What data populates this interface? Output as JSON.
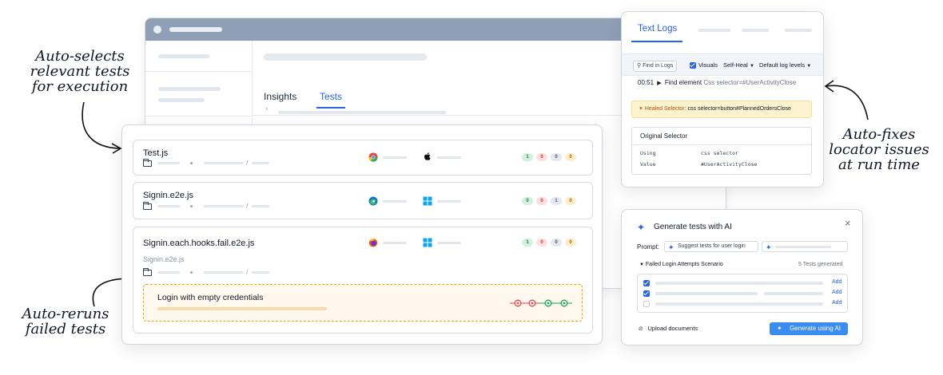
{
  "annotations": {
    "auto_selects": [
      "Auto-selects",
      "relevant tests",
      "for execution"
    ],
    "auto_fixes": [
      "Auto-fixes",
      "locator issues",
      "at run time"
    ],
    "auto_reruns": [
      "Auto-reruns",
      "failed tests"
    ]
  },
  "background_window": {
    "tabs": [
      {
        "label": "Insights",
        "active": false
      },
      {
        "label": "Tests",
        "active": true
      }
    ],
    "chevron": "›"
  },
  "tests": [
    {
      "name": "Test.js",
      "browser_icon": "chrome-icon",
      "os_icon": "apple-icon",
      "counts": {
        "passed": "1",
        "failed": "0",
        "skipped": "0",
        "flaky": "0"
      }
    },
    {
      "name": "Signin.e2e.js",
      "browser_icon": "edge-icon",
      "os_icon": "windows-icon",
      "counts": {
        "passed": "0",
        "failed": "0",
        "skipped": "1",
        "flaky": "0"
      }
    },
    {
      "name": "Signin.each.hooks.fail.e2e.js",
      "subtitle": "Signin.e2e.js",
      "browser_icon": "firefox-icon",
      "os_icon": "windows-icon",
      "counts": {
        "passed": "1",
        "failed": "0",
        "skipped": "0",
        "flaky": "0"
      },
      "failed_case": {
        "title": "Login with empty credentials",
        "retries": [
          "failed",
          "failed",
          "passed",
          "passed"
        ]
      }
    }
  ],
  "logs": {
    "tab_active": "Text Logs",
    "find_button": "Find in Logs",
    "visuals_label": "Visuals",
    "self_heal_label": "Self-Heal",
    "log_levels_label": "Default log levels",
    "entry": {
      "time": "00:51",
      "action": "Find element",
      "selector": "Css selector=#UserActivityClose"
    },
    "healed": {
      "label": "Healed Selector:",
      "value": "css selector=button#PlannedOrdersClose"
    },
    "original": {
      "title": "Original Selector",
      "rows": [
        {
          "key": "Using",
          "value": "css selector"
        },
        {
          "key": "Value",
          "value": "#UserActivityClose"
        }
      ]
    }
  },
  "ai": {
    "title": "Generate tests with AI",
    "close": "×",
    "prompt_label": "Prompt:",
    "prompt_chip": "Suggest tests for user login",
    "scenario": "Failed Login Attempts Scenario",
    "generated": "5 Tests generated",
    "rows": [
      {
        "checked": true,
        "action": "Add"
      },
      {
        "checked": true,
        "action": "Add"
      },
      {
        "checked": false,
        "action": "Add"
      }
    ],
    "upload_label": "Upload documents",
    "generate_button": "Generate using AI"
  },
  "colors": {
    "accent": "#2563eb",
    "pass": "#16a34a",
    "fail": "#ef4444",
    "retry_border": "#f59e0b"
  }
}
